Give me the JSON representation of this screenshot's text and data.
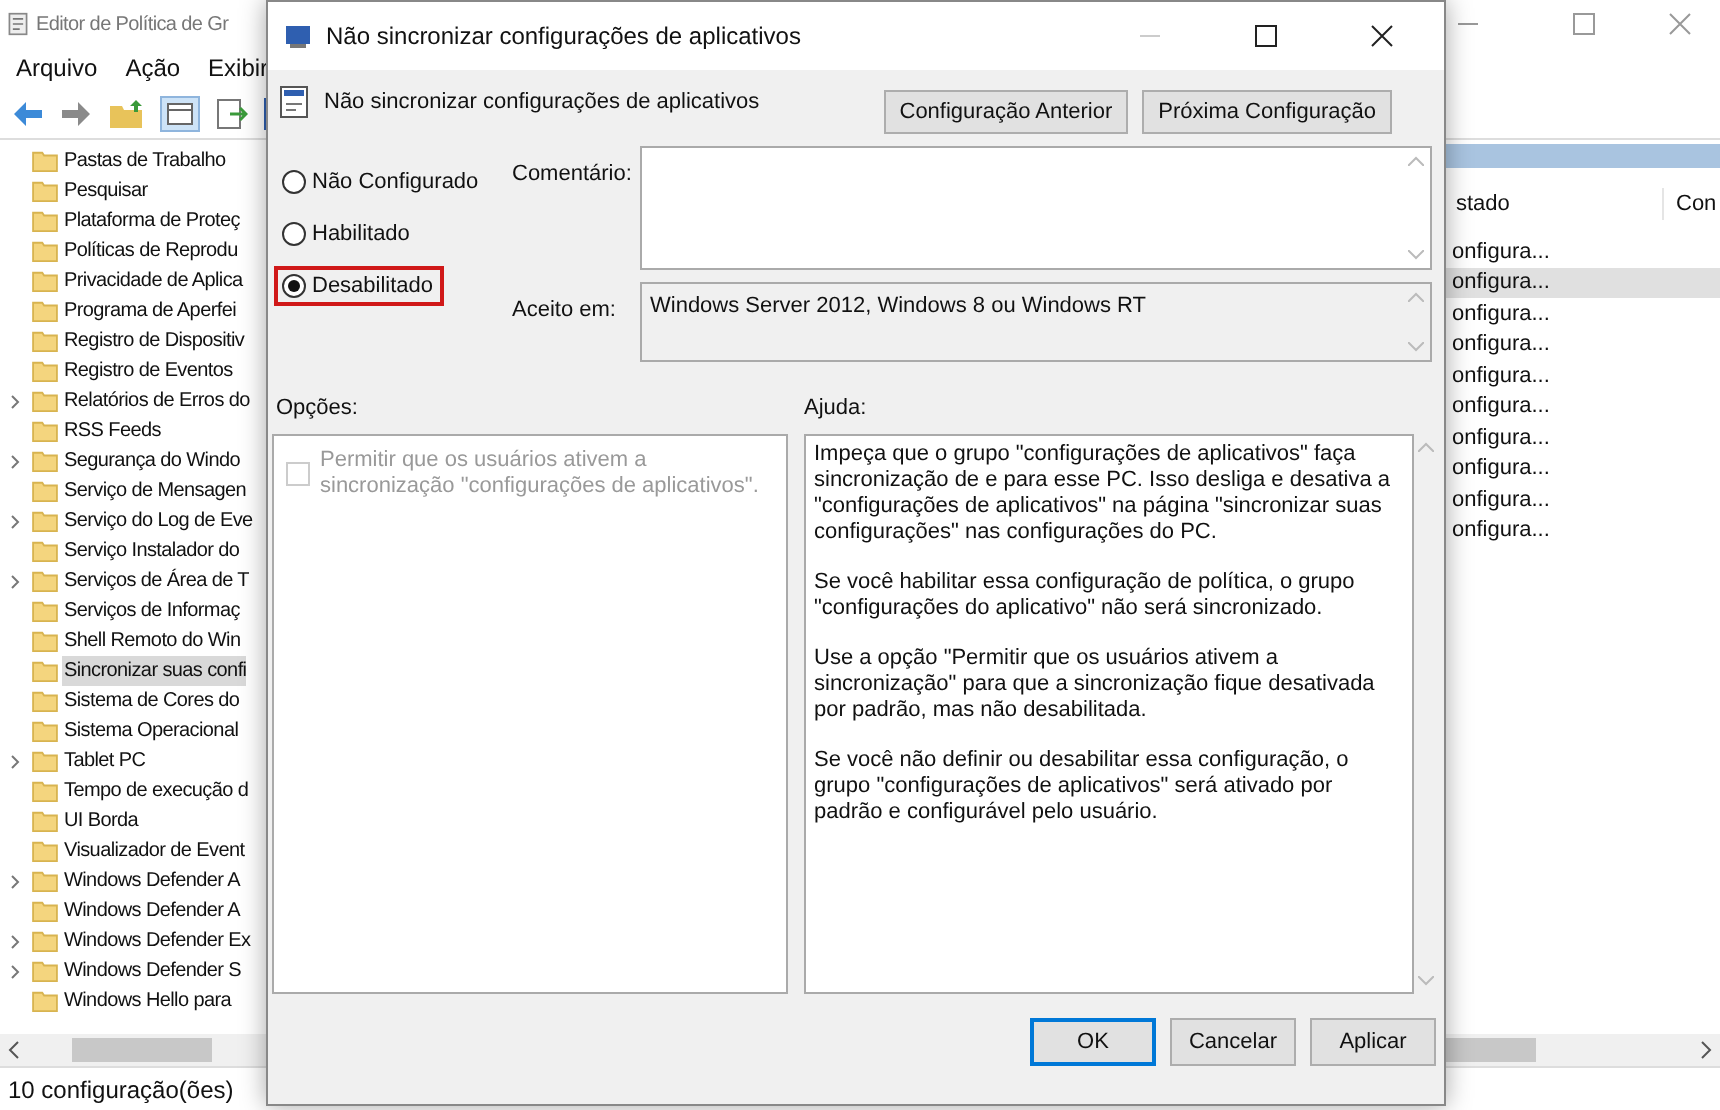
{
  "main_window": {
    "title": "Editor de Política de Gr",
    "menu": [
      "Arquivo",
      "Ação",
      "Exibir"
    ],
    "tree": [
      {
        "label": "Pastas de Trabalho",
        "expandable": false,
        "selected": false
      },
      {
        "label": "Pesquisar",
        "expandable": false,
        "selected": false
      },
      {
        "label": "Plataforma de Proteç",
        "expandable": false,
        "selected": false
      },
      {
        "label": "Políticas de Reprodu",
        "expandable": false,
        "selected": false
      },
      {
        "label": "Privacidade de Aplica",
        "expandable": false,
        "selected": false
      },
      {
        "label": "Programa de Aperfei",
        "expandable": false,
        "selected": false
      },
      {
        "label": "Registro de Dispositiv",
        "expandable": false,
        "selected": false
      },
      {
        "label": "Registro de Eventos",
        "expandable": false,
        "selected": false
      },
      {
        "label": "Relatórios de Erros do",
        "expandable": true,
        "selected": false
      },
      {
        "label": "RSS Feeds",
        "expandable": false,
        "selected": false
      },
      {
        "label": "Segurança do Windo",
        "expandable": true,
        "selected": false
      },
      {
        "label": "Serviço de Mensagen",
        "expandable": false,
        "selected": false
      },
      {
        "label": "Serviço do Log de Eve",
        "expandable": true,
        "selected": false
      },
      {
        "label": "Serviço Instalador do",
        "expandable": false,
        "selected": false
      },
      {
        "label": "Serviços de Área de T",
        "expandable": true,
        "selected": false
      },
      {
        "label": "Serviços de Informaç",
        "expandable": false,
        "selected": false
      },
      {
        "label": "Shell Remoto do Win",
        "expandable": false,
        "selected": false
      },
      {
        "label": "Sincronizar suas confi",
        "expandable": false,
        "selected": true
      },
      {
        "label": "Sistema de Cores do",
        "expandable": false,
        "selected": false
      },
      {
        "label": "Sistema Operacional",
        "expandable": false,
        "selected": false
      },
      {
        "label": "Tablet PC",
        "expandable": true,
        "selected": false
      },
      {
        "label": "Tempo de execução d",
        "expandable": false,
        "selected": false
      },
      {
        "label": "UI Borda",
        "expandable": false,
        "selected": false
      },
      {
        "label": "Visualizador de Event",
        "expandable": false,
        "selected": false
      },
      {
        "label": "Windows Defender A",
        "expandable": true,
        "selected": false
      },
      {
        "label": "Windows Defender A",
        "expandable": false,
        "selected": false
      },
      {
        "label": "Windows Defender Ex",
        "expandable": true,
        "selected": false
      },
      {
        "label": "Windows Defender S",
        "expandable": true,
        "selected": false
      },
      {
        "label": "Windows Hello para",
        "expandable": false,
        "selected": false
      }
    ],
    "list": {
      "columns": [
        "stado",
        "Con"
      ],
      "rows": [
        {
          "status": "onfigura...",
          "selected": false
        },
        {
          "status": "onfigura...",
          "selected": true
        },
        {
          "status": "onfigura...",
          "selected": false
        },
        {
          "status": "onfigura...",
          "selected": false
        },
        {
          "status": "onfigura...",
          "selected": false
        },
        {
          "status": "onfigura...",
          "selected": false
        },
        {
          "status": "onfigura...",
          "selected": false
        },
        {
          "status": "onfigura...",
          "selected": false
        },
        {
          "status": "onfigura...",
          "selected": false
        },
        {
          "status": "onfigura...",
          "selected": false
        }
      ]
    },
    "status_bar": "10 configuração(ões)"
  },
  "dialog": {
    "title": "Não sincronizar configurações de aplicativos",
    "heading": "Não sincronizar configurações de aplicativos",
    "nav_buttons": [
      "Configuração Anterior",
      "Próxima Configuração"
    ],
    "states": [
      {
        "label": "Não Configurado",
        "selected": false,
        "highlighted": false
      },
      {
        "label": "Habilitado",
        "selected": false,
        "highlighted": false
      },
      {
        "label": "Desabilitado",
        "selected": true,
        "highlighted": true
      }
    ],
    "comment_label": "Comentário:",
    "supported_label": "Aceito em:",
    "supported_value": "Windows Server 2012, Windows 8 ou Windows RT",
    "options_label": "Opções:",
    "help_label": "Ajuda:",
    "options": [
      {
        "label": "Permitir que os usuários ativem a sincronização \"configurações de aplicativos\".",
        "checked": false,
        "disabled": true
      }
    ],
    "help": [
      "Impeça que o grupo \"configurações de aplicativos\" faça sincronização de e para esse PC.  Isso desliga e desativa a \"configurações de aplicativos\" na página \"sincronizar suas configurações\" nas configurações do PC.",
      "Se você habilitar essa configuração de política, o grupo \"configurações do aplicativo\" não será sincronizado.",
      "Use a opção \"Permitir que os usuários ativem a sincronização\" para que a sincronização fique desativada por padrão, mas não desabilitada.",
      "Se você não definir ou desabilitar essa configuração, o grupo \"configurações de aplicativos\" será ativado por padrão e configurável pelo usuário."
    ],
    "buttons": [
      {
        "label": "OK",
        "default": true
      },
      {
        "label": "Cancelar",
        "default": false
      },
      {
        "label": "Aplicar",
        "default": false
      }
    ]
  }
}
